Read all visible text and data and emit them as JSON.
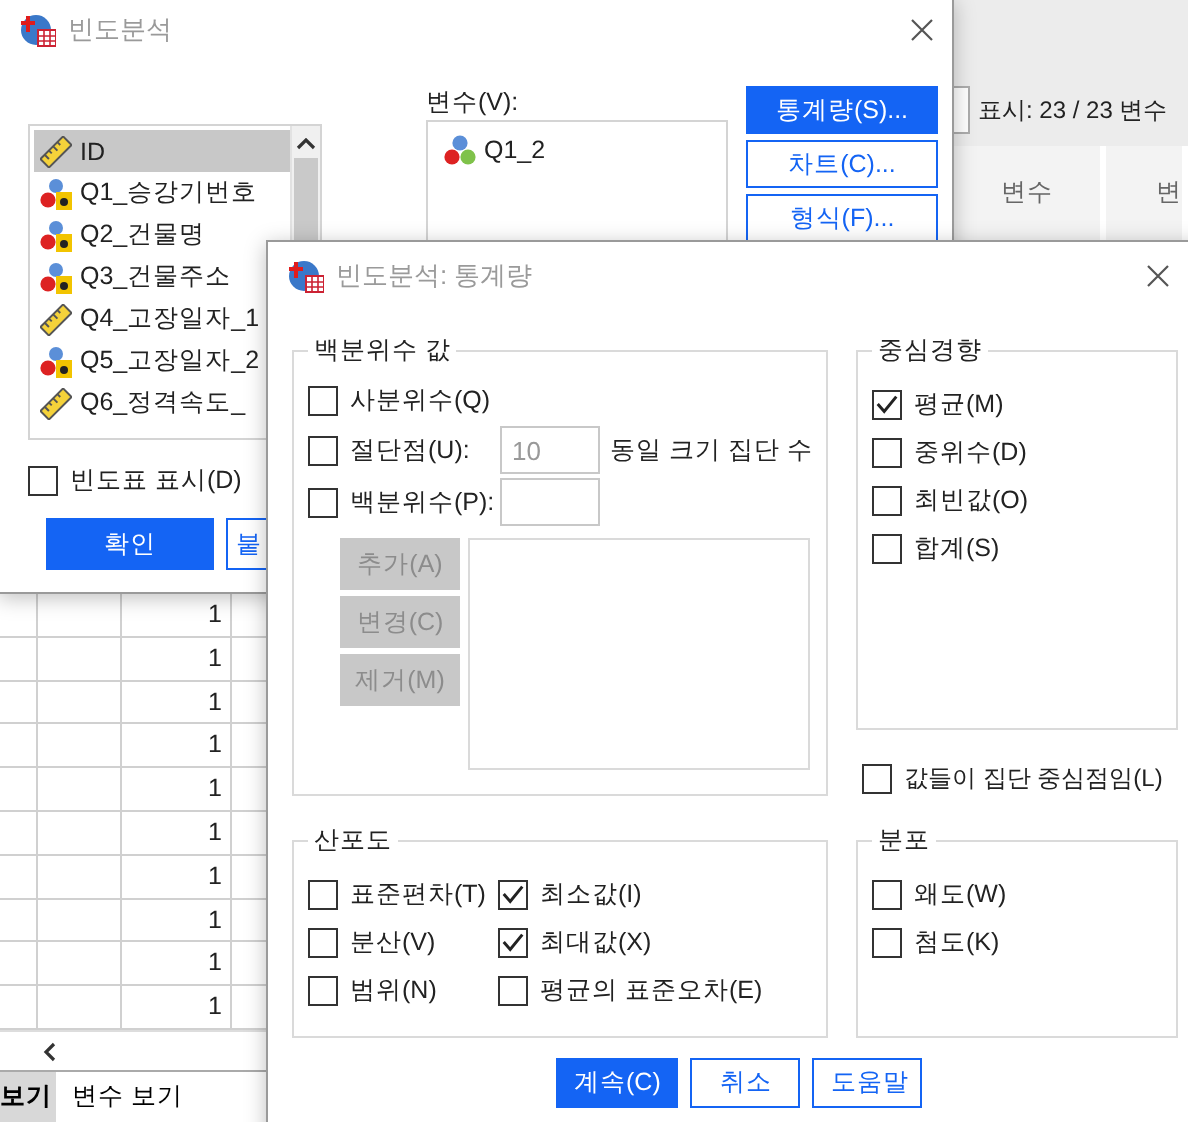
{
  "data_editor": {
    "variable_count": "표시: 23 / 23 변수",
    "columns": [
      "변수",
      "변"
    ],
    "rows": [
      "1",
      "1",
      "1",
      "1",
      "1",
      "1",
      "1",
      "1",
      "1",
      "1"
    ],
    "tabs": [
      {
        "label": "보기",
        "selected": true
      },
      {
        "label": "변수 보기",
        "selected": false
      }
    ]
  },
  "frequencies_dialog": {
    "title": "빈도분석",
    "variables": [
      {
        "name": "ID",
        "kind": "scale",
        "selected": true
      },
      {
        "name": "Q1_승강기번호",
        "kind": "string",
        "selected": false
      },
      {
        "name": "Q2_건물명",
        "kind": "string",
        "selected": false
      },
      {
        "name": "Q3_건물주소",
        "kind": "string",
        "selected": false
      },
      {
        "name": "Q4_고장일자_1",
        "kind": "scale",
        "selected": false
      },
      {
        "name": "Q5_고장일자_2",
        "kind": "string",
        "selected": false
      },
      {
        "name": "Q6_정격속도_",
        "kind": "scale",
        "selected": false
      }
    ],
    "target_label": "변수(V):",
    "targets": [
      {
        "name": "Q1_2",
        "kind": "nominal"
      }
    ],
    "side_buttons": [
      {
        "label": "통계량(S)...",
        "selected": true
      },
      {
        "label": "차트(C)...",
        "selected": false
      },
      {
        "label": "형식(F)...",
        "selected": false
      }
    ],
    "show_tables": {
      "label": "빈도표 표시(D)",
      "checked": false
    },
    "buttons": [
      {
        "label": "확인",
        "kind": "primary"
      },
      {
        "label": "붙",
        "kind": "secondary"
      }
    ]
  },
  "statistics_dialog": {
    "title": "빈도분석: 통계량",
    "percentile_values": {
      "title": "백분위수 값",
      "quartiles": {
        "label": "사분위수(Q)",
        "checked": false
      },
      "cut_points": {
        "label": "절단점(U):",
        "checked": false,
        "value": "10",
        "disabled": true,
        "suffix": "동일 크기 집단 수"
      },
      "percentiles": {
        "label": "백분위수(P):",
        "checked": false
      },
      "buttons": [
        {
          "label": "추가(A)",
          "disabled": true
        },
        {
          "label": "변경(C)",
          "disabled": true
        },
        {
          "label": "제거(M)",
          "disabled": true
        }
      ]
    },
    "central_tendency": {
      "title": "중심경향",
      "options": [
        {
          "label": "평균(M)",
          "checked": true
        },
        {
          "label": "중위수(D)",
          "checked": false
        },
        {
          "label": "최빈값(O)",
          "checked": false
        },
        {
          "label": "합계(S)",
          "checked": false
        }
      ]
    },
    "group_midpoints": {
      "label": "값들이 집단 중심점임(L)",
      "checked": false
    },
    "dispersion": {
      "title": "산포도",
      "options": [
        {
          "label": "표준편차(T)",
          "checked": false
        },
        {
          "label": "최소값(I)",
          "checked": true
        },
        {
          "label": "분산(V)",
          "checked": false
        },
        {
          "label": "최대값(X)",
          "checked": true
        },
        {
          "label": "범위(N)",
          "checked": false
        },
        {
          "label": "평균의 표준오차(E)",
          "checked": false
        }
      ]
    },
    "distribution": {
      "title": "분포",
      "options": [
        {
          "label": "왜도(W)",
          "checked": false
        },
        {
          "label": "첨도(K)",
          "checked": false
        }
      ]
    },
    "buttons": [
      {
        "label": "계속(C)",
        "kind": "primary"
      },
      {
        "label": "취소",
        "kind": "secondary"
      },
      {
        "label": "도움말",
        "kind": "secondary"
      }
    ]
  }
}
